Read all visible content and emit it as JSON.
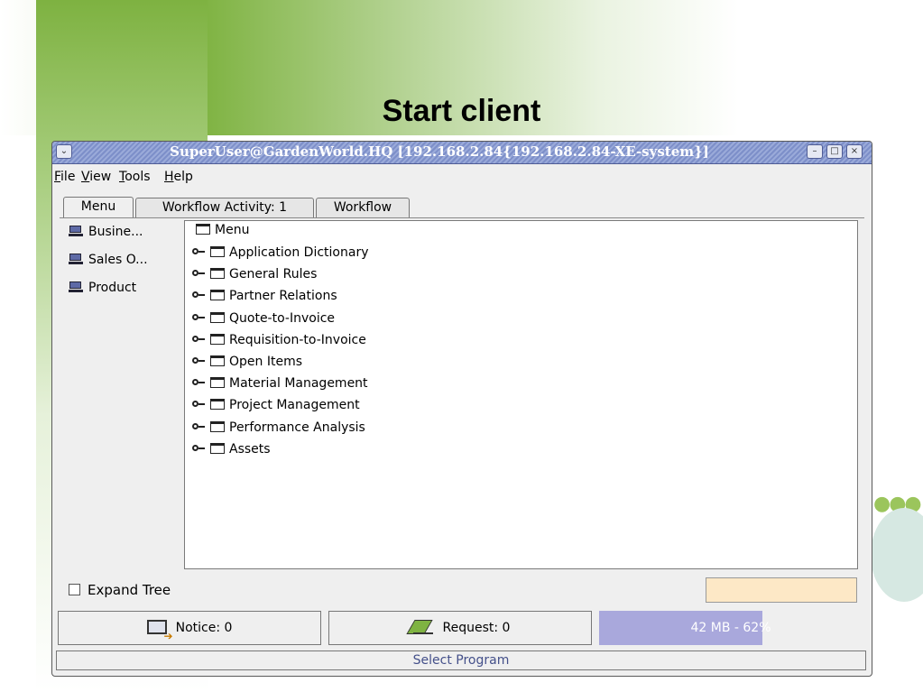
{
  "slide": {
    "title": "Start client"
  },
  "window": {
    "title": "SuperUser@GardenWorld.HQ [192.168.2.84{192.168.2.84-XE-system}]",
    "controls": {
      "menu": "⌄",
      "minimize": "–",
      "maximize": "□",
      "close": "×"
    }
  },
  "menubar": {
    "file": "File",
    "view": "View",
    "tools": "Tools",
    "help": "Help"
  },
  "tabs": [
    {
      "label": "Menu",
      "active": true
    },
    {
      "label": "Workflow Activity: 1",
      "active": false
    },
    {
      "label": "Workflow",
      "active": false
    }
  ],
  "shortcuts": [
    {
      "label": "Busine..."
    },
    {
      "label": "Sales O..."
    },
    {
      "label": "Product"
    }
  ],
  "tree": {
    "root": "Menu",
    "items": [
      "Application Dictionary",
      "General Rules",
      "Partner Relations",
      "Quote-to-Invoice",
      "Requisition-to-Invoice",
      "Open Items",
      "Material Management",
      "Project Management",
      "Performance Analysis",
      "Assets"
    ]
  },
  "expand_tree": {
    "label": "Expand Tree",
    "checked": false
  },
  "status": {
    "notice": "Notice: 0",
    "request": "Request: 0",
    "memory": "42 MB - 62%",
    "memory_fraction": 0.62,
    "message": "Select Program"
  },
  "colors": {
    "titlebar": "#7d8fc9",
    "memory_fill": "#a9a8dc",
    "accent_green": "#7fb342",
    "peach": "#fde8c6"
  }
}
